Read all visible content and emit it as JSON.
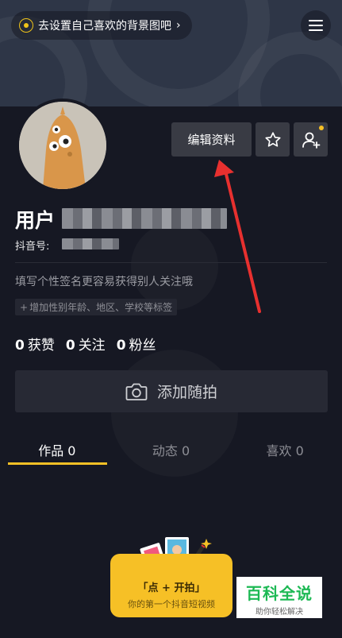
{
  "header": {
    "bg_tip": "去设置自己喜欢的背景图吧",
    "menu_icon": "hamburger-menu-icon"
  },
  "profile": {
    "username_prefix": "用户",
    "douyin_id_label": "抖音号: ",
    "bio_placeholder": "填写个性签名更容易获得别人关注哦",
    "tag_hint": "增加性别年龄、地区、学校等标签"
  },
  "actions": {
    "edit_label": "编辑资料",
    "star_icon": "star-icon",
    "add_friend_icon": "add-friend-icon"
  },
  "stats": [
    {
      "value": "0",
      "label": "获赞"
    },
    {
      "value": "0",
      "label": "关注"
    },
    {
      "value": "0",
      "label": "粉丝"
    }
  ],
  "add_photo": {
    "label": "添加随拍",
    "icon": "camera-icon"
  },
  "tabs": [
    {
      "label": "作品 0",
      "active": true
    },
    {
      "label": "动态 0",
      "active": false
    },
    {
      "label": "喜欢 0",
      "active": false
    }
  ],
  "promo": {
    "title": "「点 + 开拍」",
    "subtitle": "你的第一个抖音短视频"
  },
  "watermark": {
    "main": "百科全说",
    "sub": "助你轻松解决"
  },
  "colors": {
    "background": "#161823",
    "accent": "#f6c026",
    "button": "#393b44",
    "arrow": "#e8302f"
  }
}
